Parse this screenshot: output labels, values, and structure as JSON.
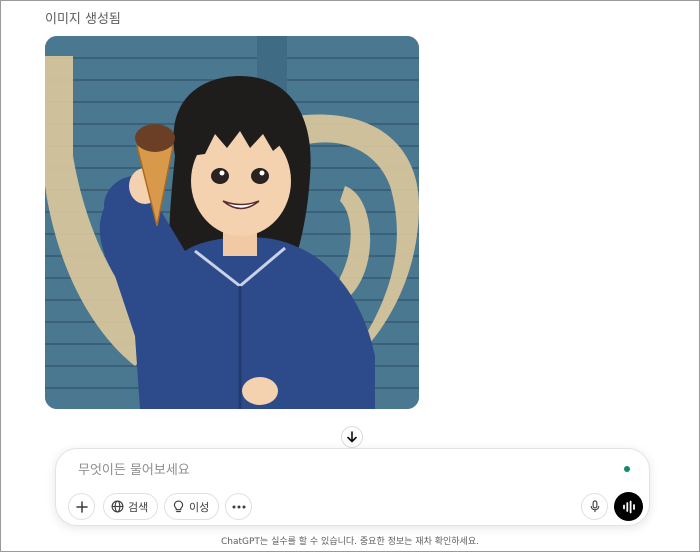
{
  "status_label": "이미지 생성됨",
  "composer": {
    "placeholder": "무엇이든 물어보세요",
    "value": "",
    "add_icon": "plus-icon",
    "search_label": "검색",
    "search_icon": "globe-icon",
    "reason_label": "이성",
    "reason_icon": "lightbulb-icon",
    "more_icon": "ellipsis-icon",
    "mic_icon": "microphone-icon",
    "voice_icon": "voice-mode-icon",
    "status_dot_color": "#0f8a6a"
  },
  "scroll_icon": "arrow-down-icon",
  "disclaimer": "ChatGPT는 실수를 할 수 있습니다. 중요한 정보는 재차 확인하세요.",
  "colors": {
    "background": "#ffffff",
    "voice_button": "#000000",
    "image_wall": "#4b7891"
  }
}
